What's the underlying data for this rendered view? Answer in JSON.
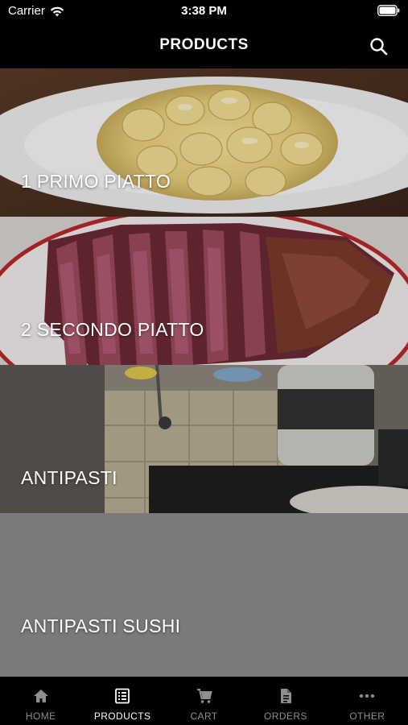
{
  "status_bar": {
    "carrier": "Carrier",
    "time": "3:38 PM"
  },
  "nav": {
    "title": "PRODUCTS"
  },
  "categories": [
    {
      "label": "1 PRIMO PIATTO"
    },
    {
      "label": "2 SECONDO PIATTO"
    },
    {
      "label": "ANTIPASTI"
    },
    {
      "label": "ANTIPASTI SUSHI"
    }
  ],
  "tabs": [
    {
      "label": "HOME",
      "icon": "home-icon",
      "active": false
    },
    {
      "label": "PRODUCTS",
      "icon": "list-icon",
      "active": true
    },
    {
      "label": "CART",
      "icon": "cart-icon",
      "active": false
    },
    {
      "label": "ORDERS",
      "icon": "document-icon",
      "active": false
    },
    {
      "label": "OTHER",
      "icon": "more-icon",
      "active": false
    }
  ]
}
